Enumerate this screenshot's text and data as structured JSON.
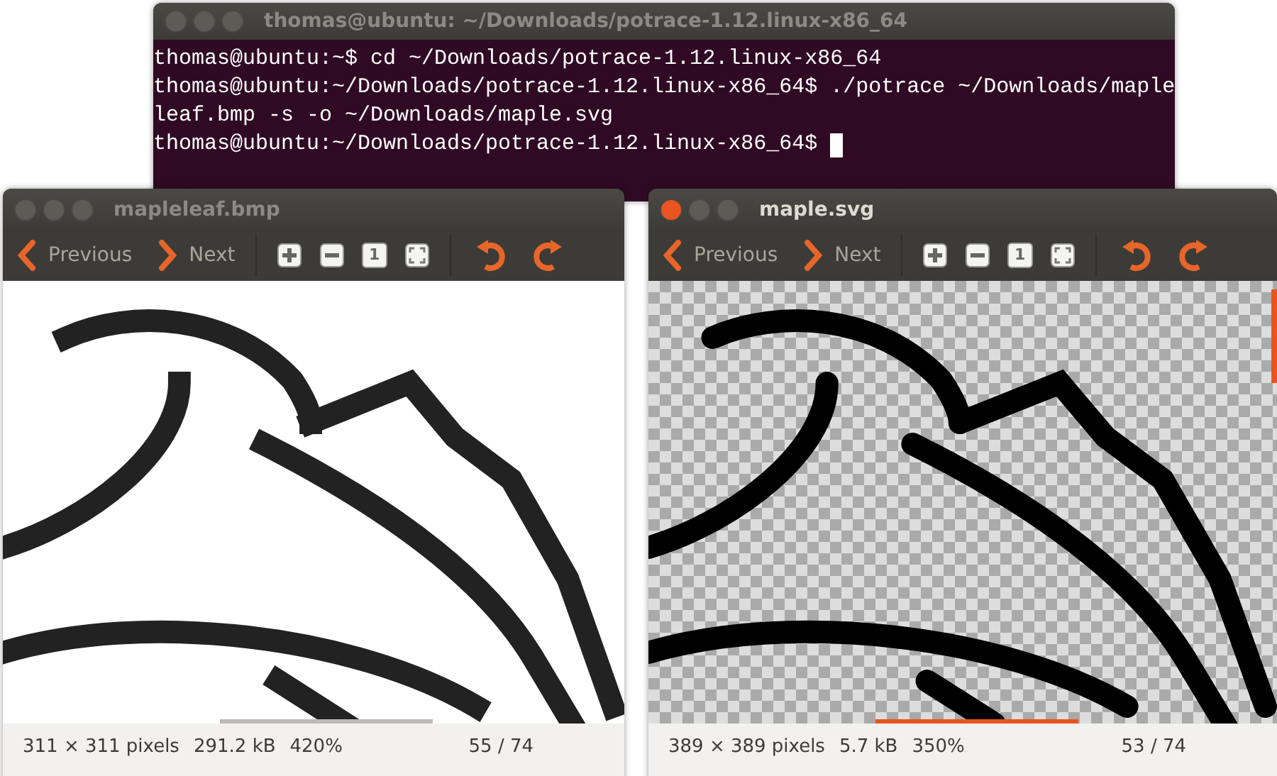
{
  "terminal": {
    "title": "thomas@ubuntu: ~/Downloads/potrace-1.12.linux-x86_64",
    "active": false,
    "lines": [
      "thomas@ubuntu:~$ cd ~/Downloads/potrace-1.12.linux-x86_64",
      "thomas@ubuntu:~/Downloads/potrace-1.12.linux-x86_64$ ./potrace ~/Downloads/maple",
      "leaf.bmp -s -o ~/Downloads/maple.svg",
      "thomas@ubuntu:~/Downloads/potrace-1.12.linux-x86_64$ "
    ]
  },
  "viewers": [
    {
      "title": "mapleleaf.bmp",
      "active": false,
      "previous": "Previous",
      "next": "Next",
      "one_label": "1",
      "kind": "bitmap",
      "status": {
        "dimensions": "311 × 311 pixels",
        "size": "291.2 kB",
        "zoom": "420%",
        "position": "55 / 74"
      }
    },
    {
      "title": "maple.svg",
      "active": true,
      "previous": "Previous",
      "next": "Next",
      "one_label": "1",
      "kind": "vector",
      "status": {
        "dimensions": "389 × 389 pixels",
        "size": "5.7 kB",
        "zoom": "350%",
        "position": "53 / 74"
      }
    }
  ]
}
